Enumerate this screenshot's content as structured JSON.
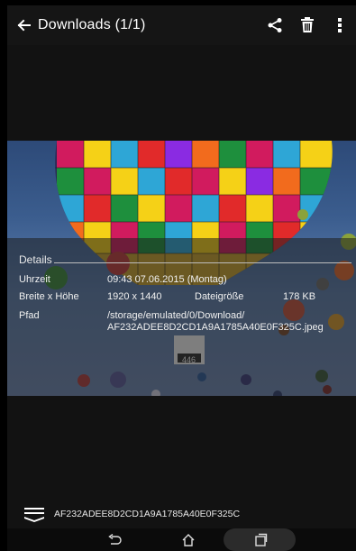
{
  "app_bar": {
    "title": "Downloads (1/1)",
    "icons": [
      "back-arrow-icon",
      "share-icon",
      "trash-icon",
      "more-vert-icon"
    ]
  },
  "photo": {
    "description_icon": "hot-air-balloon-photo"
  },
  "details": {
    "heading": "Details",
    "time_label": "Uhrzeit",
    "time_value": "09:43 07.06.2015 (Montag)",
    "size_label": "Breite x Höhe",
    "size_value": "1920 x 1440",
    "filesize_label": "Dateigröße",
    "filesize_value": "178 KB",
    "path_label": "Pfad",
    "path_line1": "/storage/emulated/0/Download/",
    "path_line2": "AF232ADEE8D2CD1A9A1785A40E0F325C.jpeg"
  },
  "bottom_bar": {
    "filename": "AF232ADEE8D2CD1A9A1785A40E0F325C",
    "icon": "menu-expand-icon"
  },
  "system_nav": {
    "icons": [
      "nav-back-icon",
      "nav-home-icon",
      "nav-recents-icon"
    ]
  }
}
